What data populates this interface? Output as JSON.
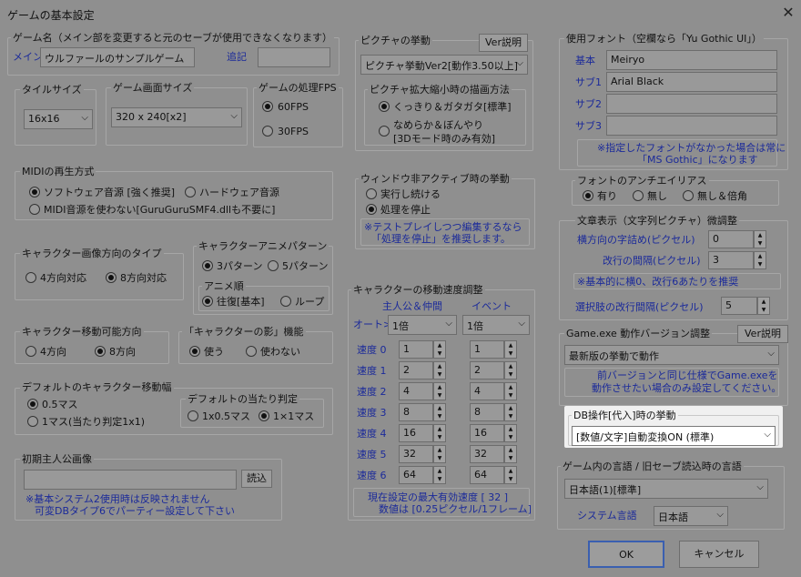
{
  "window": {
    "title": "ゲームの基本設定"
  },
  "game_name": {
    "label": "ゲーム名（メイン部を変更すると元のセーブが使用できなくなります）",
    "main_label": "メイン",
    "main_value": "ウルファールのサンプルゲーム",
    "sub_label": "追記",
    "sub_value": ""
  },
  "tile": {
    "label": "タイルサイズ",
    "value": "16x16"
  },
  "screen": {
    "label": "ゲーム画面サイズ",
    "value": "320 x 240[x2]"
  },
  "fps": {
    "label": "ゲームの処理FPS",
    "options": [
      "60FPS",
      "30FPS"
    ]
  },
  "picture": {
    "label": "ピクチャの挙動",
    "help": "Ver説明",
    "value": "ピクチャ挙動Ver2[動作3.50以上]",
    "scale_label": "ピクチャ拡大縮小時の描画方法",
    "scale_opt1": "くっきり＆ガタガタ[標準]",
    "scale_opt2_l1": "なめらか＆ぼんやり",
    "scale_opt2_l2": "[3Dモード時のみ有効]"
  },
  "font": {
    "label": "使用フォント（空欄なら「Yu Gothic UI」）",
    "rows": [
      {
        "name": "基本",
        "value": "Meiryo"
      },
      {
        "name": "サブ1",
        "value": "Arial Black"
      },
      {
        "name": "サブ2",
        "value": ""
      },
      {
        "name": "サブ3",
        "value": ""
      }
    ],
    "note1": "※指定したフォントがなかった場合は常に",
    "note2": "「MS Gothic」になります"
  },
  "aa": {
    "label": "フォントのアンチエイリアス",
    "options": [
      "有り",
      "無し",
      "無し＆倍角"
    ]
  },
  "midi": {
    "label": "MIDIの再生方式",
    "opt1": "ソフトウェア音源 [強く推奨]",
    "opt2": "ハードウェア音源",
    "opt3": "MIDI音源を使わない[GuruGuruSMF4.dllも不要に]"
  },
  "inactive": {
    "label": "ウィンドウ非アクティブ時の挙動",
    "opt1": "実行し続ける",
    "opt2": "処理を停止",
    "note1": "※テストプレイしつつ編集するなら",
    "note2": "「処理を停止」を推奨します。"
  },
  "text": {
    "label": "文章表示（文字列ピクチャ）微調整",
    "hspace_label": "横方向の字詰め(ピクセル)",
    "hspace": "0",
    "line_label": "改行の間隔(ピクセル)",
    "line": "3",
    "note": "※基本的に横0、改行6あたりを推奨",
    "choice_label": "選択肢の改行間隔(ピクセル)",
    "choice": "5"
  },
  "dir": {
    "label": "キャラクター画像方向のタイプ",
    "opt1": "4方向対応",
    "opt2": "8方向対応"
  },
  "anim": {
    "label": "キャラクターアニメパターン",
    "opt1": "3パターン",
    "opt2": "5パターン",
    "order_label": "アニメ順",
    "order1": "往復[基本]",
    "order2": "ループ"
  },
  "speed": {
    "label": "キャラクターの移動速度調整",
    "col1": "主人公＆仲間",
    "col2": "イベント",
    "auto_label": "オート>",
    "auto1": "1倍",
    "auto2": "1倍",
    "rows": [
      {
        "label": "速度 0",
        "a": "1",
        "b": "1"
      },
      {
        "label": "速度 1",
        "a": "2",
        "b": "2"
      },
      {
        "label": "速度 2",
        "a": "4",
        "b": "4"
      },
      {
        "label": "速度 3",
        "a": "8",
        "b": "8"
      },
      {
        "label": "速度 4",
        "a": "16",
        "b": "16"
      },
      {
        "label": "速度 5",
        "a": "32",
        "b": "32"
      },
      {
        "label": "速度 6",
        "a": "64",
        "b": "64"
      }
    ],
    "footer1": "現在設定の最大有効速度 [ 32 ]",
    "footer2": "数値は [0.25ピクセル/1フレーム]"
  },
  "movable": {
    "label": "キャラクター移動可能方向",
    "opt1": "4方向",
    "opt2": "8方向"
  },
  "shadow": {
    "label": "「キャラクターの影」機能",
    "opt1": "使う",
    "opt2": "使わない"
  },
  "width": {
    "label": "デフォルトのキャラクター移動幅",
    "opt1": "0.5マス",
    "opt2": "1マス(当たり判定1x1)"
  },
  "hit": {
    "label": "デフォルトの当たり判定",
    "opt1": "1x0.5マス",
    "opt2": "1×1マス"
  },
  "hero": {
    "label": "初期主人公画像",
    "value": "",
    "read": "読込",
    "note1": "※基本システム2使用時は反映されません",
    "note2": "可変DBタイプ6でパーティー設定して下さい"
  },
  "exe": {
    "label": "Game.exe 動作バージョン調整",
    "help": "Ver説明",
    "value": "最新版の挙動で動作",
    "note1": "前バージョンと同じ仕様でGame.exeを",
    "note2": "動作させたい場合のみ設定してください。"
  },
  "db": {
    "label": "DB操作[代入]時の挙動",
    "value": "[数値/文字]自動変換ON (標準)"
  },
  "lang": {
    "label": "ゲーム内の言語 / 旧セーブ読込時の言語",
    "value": "日本語(1)[標準]",
    "sys_label": "システム言語",
    "sys_value": "日本語"
  },
  "buttons": {
    "ok": "OK",
    "cancel": "キャンセル"
  }
}
